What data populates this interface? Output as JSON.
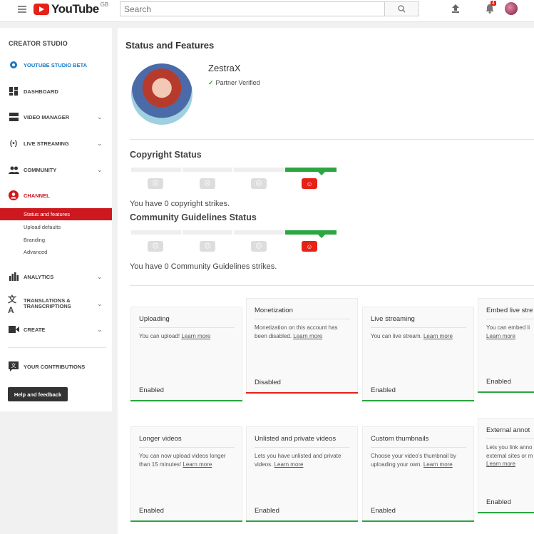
{
  "topbar": {
    "brand": "YouTube",
    "region": "GB",
    "search_placeholder": "Search",
    "notification_count": "4"
  },
  "sidebar": {
    "title": "CREATOR STUDIO",
    "items": [
      {
        "label": "YOUTUBE STUDIO BETA",
        "icon": "gear-icon"
      },
      {
        "label": "DASHBOARD",
        "icon": "dashboard-icon"
      },
      {
        "label": "VIDEO MANAGER",
        "icon": "video-manager-icon"
      },
      {
        "label": "LIVE STREAMING",
        "icon": "live-icon"
      },
      {
        "label": "COMMUNITY",
        "icon": "people-icon"
      },
      {
        "label": "CHANNEL",
        "icon": "user-icon"
      },
      {
        "label": "ANALYTICS",
        "icon": "bar-chart-icon"
      },
      {
        "label": "TRANSLATIONS &",
        "label2": "TRANSCRIPTIONS",
        "icon": "translate-icon"
      },
      {
        "label": "CREATE",
        "icon": "video-camera-icon"
      },
      {
        "label": "YOUR CONTRIBUTIONS",
        "icon": "contributions-icon"
      }
    ],
    "channel_sub": [
      "Status and features",
      "Upload defaults",
      "Branding",
      "Advanced"
    ],
    "help": "Help and feedback"
  },
  "main": {
    "title": "Status and Features",
    "channel_name": "ZestraX",
    "verified": "Partner Verified",
    "copyright_title": "Copyright Status",
    "copyright_text": "You have 0 copyright strikes.",
    "community_title": "Community Guidelines Status",
    "community_text": "You have 0 Community Guidelines strikes."
  },
  "features": [
    {
      "title": "Uploading",
      "desc": "You can upload!",
      "learn": "Learn more",
      "status": "Enabled"
    },
    {
      "title": "Monetization",
      "desc": "Monetization on this account has been disabled.",
      "learn": "Learn more",
      "status": "Disabled"
    },
    {
      "title": "Live streaming",
      "desc": "You can live stream.",
      "learn": "Learn more",
      "status": "Enabled"
    },
    {
      "title": "Embed live stre",
      "desc": "You can embed li",
      "learn": "Learn more",
      "status": "Enabled"
    },
    {
      "title": "Longer videos",
      "desc": "You can now upload videos longer than 15 minutes!",
      "learn": "Learn more",
      "status": "Enabled"
    },
    {
      "title": "Unlisted and private videos",
      "desc": "Lets you have unlisted and private videos.",
      "learn": "Learn more",
      "status": "Enabled"
    },
    {
      "title": "Custom thumbnails",
      "desc": "Choose your video's thumbnail by uploading your own.",
      "learn": "Learn more",
      "status": "Enabled"
    },
    {
      "title": "External annot",
      "desc": "Lets you link anno external sites or m",
      "learn": "Learn more",
      "status": "Enabled"
    }
  ],
  "colors": {
    "accent_red": "#e62117",
    "enabled_green": "#2ba640",
    "link_blue": "#167ac6"
  }
}
